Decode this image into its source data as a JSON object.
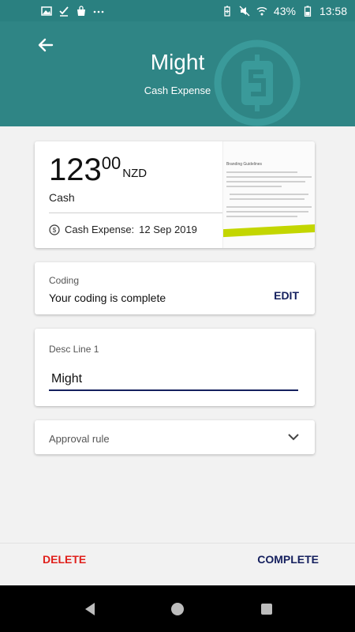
{
  "status_bar": {
    "battery_percent": "43%",
    "time": "13:58",
    "left_icons": [
      "image-icon",
      "check-icon",
      "bag-icon",
      "more-dots-icon"
    ],
    "right_icons": [
      "battery-saver-icon",
      "mute-icon",
      "wifi-icon",
      "battery-icon"
    ]
  },
  "header": {
    "title": "Might",
    "subtitle": "Cash Expense",
    "background_color": "#2f8585"
  },
  "amount_card": {
    "whole": "123",
    "cents": "00",
    "currency": "NZD",
    "payment_type": "Cash",
    "expense_type": "Cash Expense:",
    "date": "12 Sep 2019",
    "receipt_thumbnail_title": "Branding Guidelines"
  },
  "coding": {
    "label": "Coding",
    "value": "Your coding is complete",
    "edit_label": "EDIT"
  },
  "description": {
    "label": "Desc Line 1",
    "value": "Might"
  },
  "approval": {
    "label": "Approval rule"
  },
  "actions": {
    "delete_label": "DELETE",
    "complete_label": "COMPLETE",
    "delete_color": "#e0201c",
    "complete_color": "#15205e"
  }
}
